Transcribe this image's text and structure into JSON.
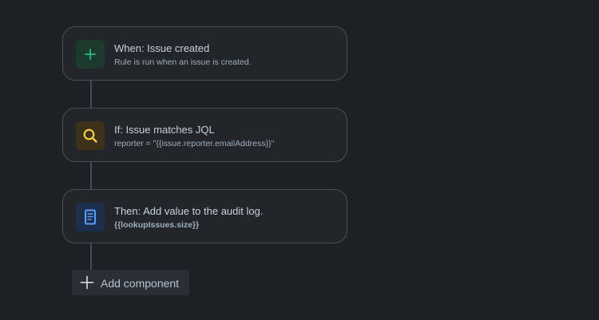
{
  "rule": {
    "trigger": {
      "title": "When: Issue created",
      "subtitle": "Rule is run when an issue is created.",
      "icon": "plus-icon",
      "color": "#2abb7f"
    },
    "condition": {
      "title": "If: Issue matches JQL",
      "subtitle": "reporter = \"{{issue.reporter.emailAddress}}\"",
      "icon": "search-icon",
      "color": "#f5cd47"
    },
    "action": {
      "title": "Then: Add value to the audit log.",
      "subtitle": "{{lookupIssues.size}}",
      "icon": "document-icon",
      "color": "#579dff"
    }
  },
  "add_component": {
    "label": "Add component",
    "icon": "plus-icon"
  }
}
